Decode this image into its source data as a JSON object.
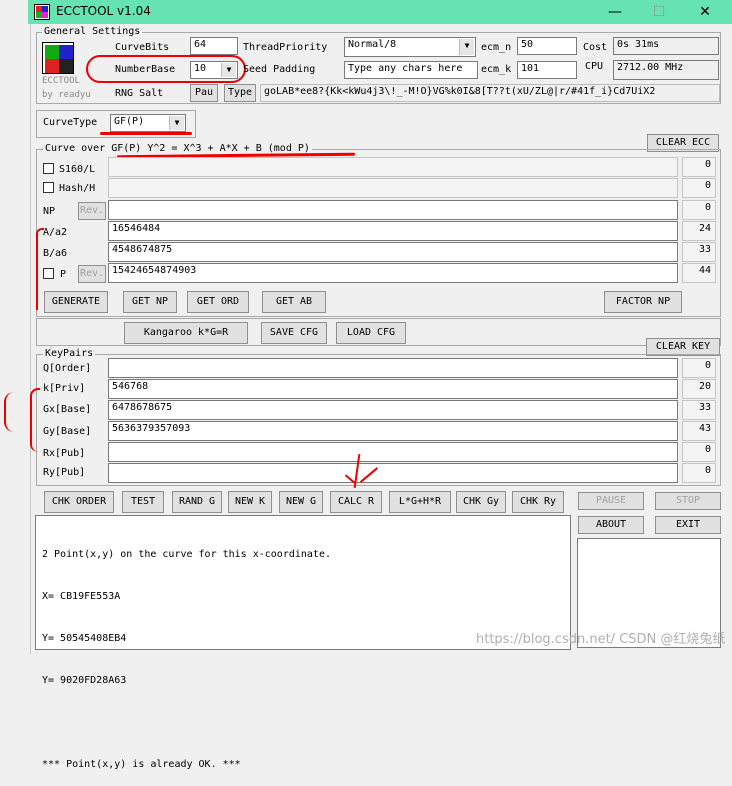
{
  "window": {
    "title": "ECCTOOL v1.04",
    "minimize": "—",
    "maximize": "☐",
    "close": "✕"
  },
  "general": {
    "label": "General Settings",
    "logo_text": "ECCTOOL",
    "logo_sub": "by readyu",
    "curve_bits_label": "CurveBits",
    "curve_bits": "64",
    "number_base_label": "NumberBase",
    "number_base": "10",
    "thread_label": "ThreadPriority",
    "thread": "Normal/8",
    "seed_label": "Seed Padding",
    "seed_placeholder": "Type any chars here",
    "ecm_n_label": "ecm_n",
    "ecm_n": "50",
    "ecm_k_label": "ecm_k",
    "ecm_k": "101",
    "cost_label": "Cost",
    "cost": "0s 31ms",
    "cpu_label": "CPU",
    "cpu": "2712.00 MHz",
    "rng_label": "RNG Salt",
    "pau": "Pau",
    "type": "Type",
    "salt": "goLAB*ee8?{Kk<kWu4j3\\!_-M!O}VG%k0I&8[T??t(xU/ZL@|r/#41f_i}Cd7UiX2"
  },
  "curve": {
    "type_label": "CurveType",
    "type": "GF(P)",
    "clear_ecc": "CLEAR ECC",
    "group_label": "Curve over GF(P) Y^2 = X^3 + A*X + B (mod P)",
    "s160": "S160/L",
    "s160_count": "0",
    "hash": "Hash/H",
    "hash_count": "0",
    "np_label": "NP",
    "rev": "Rev.",
    "np_count": "0",
    "a_label": "A/a2",
    "a_value": "16546484",
    "a_count": "24",
    "b_label": "B/a6",
    "b_value": "4548674875",
    "b_count": "33",
    "p_label": "P",
    "p_value": "15424654874903",
    "p_count": "44",
    "buttons": {
      "generate": "GENERATE",
      "get_np": "GET NP",
      "get_ord": "GET ORD",
      "get_ab": "GET AB",
      "factor_np": "FACTOR NP",
      "kangaroo": "Kangaroo k*G=R",
      "save_cfg": "SAVE CFG",
      "load_cfg": "LOAD CFG"
    }
  },
  "keypairs": {
    "label": "KeyPairs",
    "clear_key": "CLEAR KEY",
    "rows": [
      {
        "label": "Q[Order]",
        "value": "",
        "count": "0"
      },
      {
        "label": "k[Priv]",
        "value": "546768",
        "count": "20"
      },
      {
        "label": "Gx[Base]",
        "value": "6478678675",
        "count": "33"
      },
      {
        "label": "Gy[Base]",
        "value": "5636379357093",
        "count": "43"
      },
      {
        "label": "Rx[Pub]",
        "value": "",
        "count": "0"
      },
      {
        "label": "Ry[Pub]",
        "value": "",
        "count": "0"
      }
    ]
  },
  "actions": {
    "chk_order": "CHK ORDER",
    "test": "TEST",
    "rand_g": "RAND G",
    "new_k": "NEW K",
    "new_g": "NEW G",
    "calc_r": "CALC R",
    "lghr": "L*G+H*R",
    "chk_gy": "CHK Gy",
    "chk_ry": "CHK Ry",
    "pause": "PAUSE",
    "stop": "STOP",
    "about": "ABOUT",
    "exit": "EXIT"
  },
  "output": {
    "lines": [
      "2 Point(x,y) on the curve for this x-coordinate.",
      "X= CB19FE553A",
      "Y= 50545408EB4",
      "Y= 9020FD28A63",
      "",
      "*** Point(x,y) is already OK. ***"
    ]
  },
  "watermark": "https://blog.csdn.net/  CSDN @红烧兔纸",
  "colors": {
    "titlebar": "#66e3b3",
    "annotation": "#ee0000"
  }
}
